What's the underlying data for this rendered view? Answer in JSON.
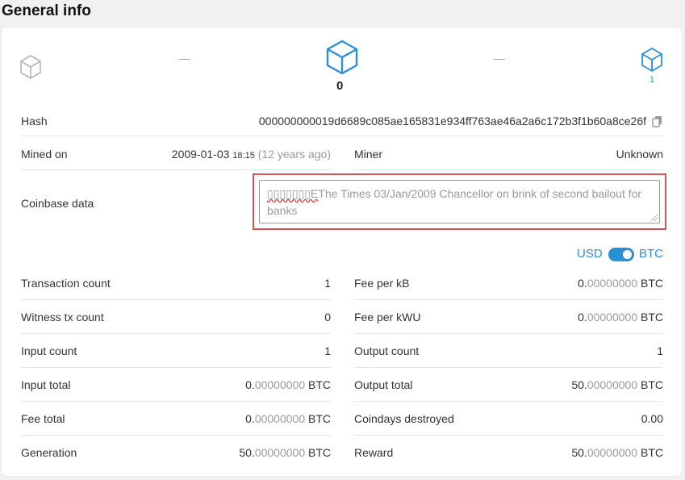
{
  "page_title": "General info",
  "nav": {
    "prev_dash": "—",
    "next_dash": "—",
    "current_height": "0",
    "next_height": "1"
  },
  "hash": {
    "label": "Hash",
    "value": "000000000019d6689c085ae165831e934ff763ae46a2a6c172b3f1b60a8ce26f"
  },
  "mined": {
    "label": "Mined on",
    "date": "2009-01-03",
    "time": "18:15",
    "ago": "(12 years ago)"
  },
  "miner": {
    "label": "Miner",
    "value": "Unknown"
  },
  "coinbase": {
    "label": "Coinbase data",
    "garbled_prefix": "▯▯▯▯▯▯▯E",
    "text": "The Times 03/Jan/2009 Chancellor on brink of second bailout for banks"
  },
  "currency_toggle": {
    "left": "USD",
    "right": "BTC"
  },
  "left_rows": [
    {
      "label": "Transaction count",
      "value": "1"
    },
    {
      "label": "Witness tx count",
      "value": "0"
    },
    {
      "label": "Input count",
      "value": "1"
    },
    {
      "label": "Input total",
      "int": "0.",
      "dec": "00000000",
      "unit": " BTC"
    },
    {
      "label": "Fee total",
      "int": "0.",
      "dec": "00000000",
      "unit": " BTC"
    },
    {
      "label": "Generation",
      "int": "50.",
      "dec": "00000000",
      "unit": " BTC"
    }
  ],
  "right_rows": [
    {
      "label": "Fee per kB",
      "int": "0.",
      "dec": "00000000",
      "unit": " BTC"
    },
    {
      "label": "Fee per kWU",
      "int": "0.",
      "dec": "00000000",
      "unit": " BTC"
    },
    {
      "label": "Output count",
      "value": "1"
    },
    {
      "label": "Output total",
      "int": "50.",
      "dec": "00000000",
      "unit": " BTC"
    },
    {
      "label": "Coindays destroyed",
      "value": "0.00"
    },
    {
      "label": "Reward",
      "int": "50.",
      "dec": "00000000",
      "unit": " BTC"
    }
  ],
  "colors": {
    "accent": "#2a90d4",
    "highlight_border": "#d65151"
  }
}
